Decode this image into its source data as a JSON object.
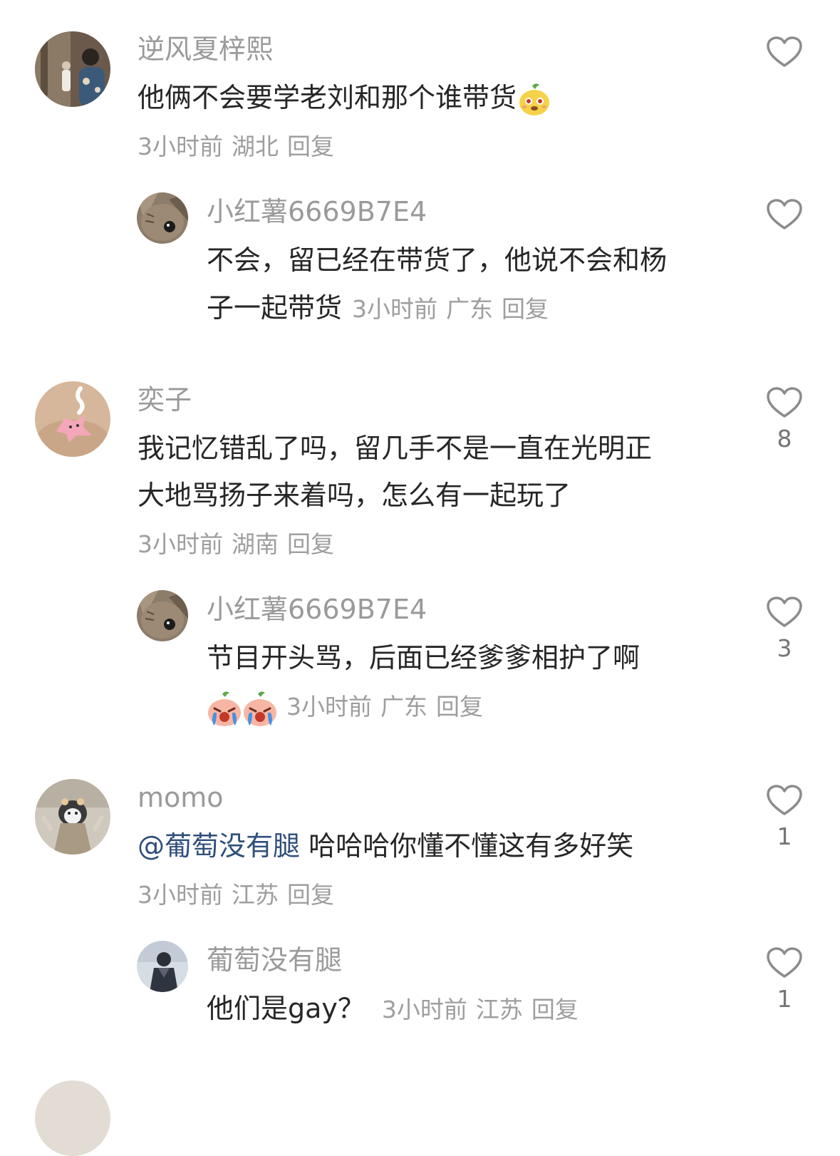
{
  "comments": [
    {
      "username": "逆风夏梓熙",
      "text": "他俩不会要学老刘和那个谁带货",
      "time": "3小时前",
      "location": "湖北",
      "reply": "回复",
      "likes": "",
      "emoji": "pear-face-emoji",
      "replies": [
        {
          "username": "小红薯6669B7E4",
          "text_line1": "不会，留已经在带货了，他说不会和杨",
          "text_line2": "子一起带货",
          "time": "3小时前",
          "location": "广东",
          "reply": "回复",
          "likes": ""
        }
      ]
    },
    {
      "username": "奕子",
      "text_line1": "我记忆错乱了吗，留几手不是一直在光明正",
      "text_line2": "大地骂扬子来着吗，怎么有一起玩了",
      "time": "3小时前",
      "location": "湖南",
      "reply": "回复",
      "likes": "8",
      "replies": [
        {
          "username": "小红薯6669B7E4",
          "text": "节目开头骂，后面已经爹爹相护了啊",
          "emojis": [
            "crying-face-emoji",
            "crying-face-emoji"
          ],
          "time": "3小时前",
          "location": "广东",
          "reply": "回复",
          "likes": "3"
        }
      ]
    },
    {
      "username": "momo",
      "mention": "@葡萄没有腿",
      "text": "哈哈哈你懂不懂这有多好笑",
      "time": "3小时前",
      "location": "江苏",
      "reply": "回复",
      "likes": "1",
      "replies": [
        {
          "username": "葡萄没有腿",
          "text": "他们是gay？",
          "time": "3小时前",
          "location": "江苏",
          "reply": "回复",
          "likes": "1"
        }
      ]
    }
  ],
  "colors": {
    "username": "#9a9a9a",
    "text": "#262626",
    "meta": "#9e9e9e",
    "mention": "#2f4e7c",
    "heart_outline": "#8c8c8c"
  }
}
